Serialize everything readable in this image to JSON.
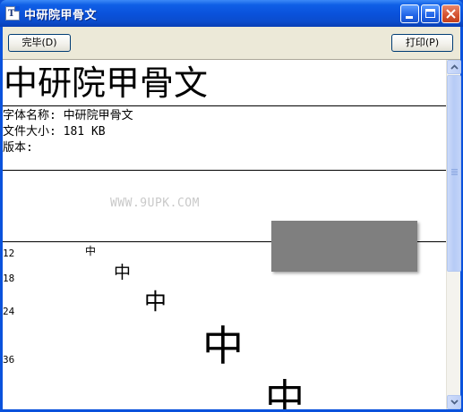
{
  "window": {
    "title": "中研院甲骨文",
    "icon": "font-file-icon",
    "icon_glyph": "T"
  },
  "toolbar": {
    "done_label": "完毕(D)",
    "print_label": "打印(P)"
  },
  "content": {
    "font_display": "中研院甲骨文",
    "info_name": "字体名称: 中研院甲骨文",
    "info_size": "文件大小: 181 KB",
    "info_version": "版本:",
    "watermark": "WWW.9UPK.COM",
    "sample_char": "中",
    "sizes": [
      "12",
      "18",
      "24",
      "36"
    ]
  },
  "colors": {
    "titlebar": "#0a52dc",
    "close_button": "#d4512f",
    "toolbar_bg": "#ece9d8",
    "overlay_box": "#7f7f7f"
  }
}
